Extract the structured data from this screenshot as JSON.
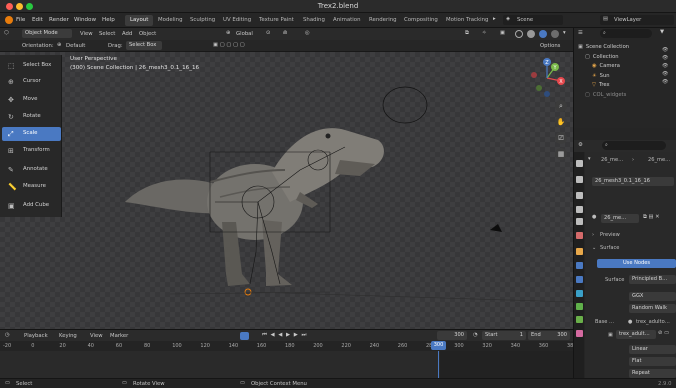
{
  "window": {
    "title": "Trex2.blend"
  },
  "colors": {
    "accent": "#4a79c2",
    "close": "#ff5f57",
    "minimize": "#febc2e",
    "zoom": "#28c840",
    "playhead": "#4a79c2"
  },
  "menu": {
    "items": [
      "File",
      "Edit",
      "Render",
      "Window",
      "Help"
    ],
    "workspaces": [
      "Layout",
      "Modeling",
      "Sculpting",
      "UV Editing",
      "Texture Paint",
      "Shading",
      "Animation",
      "Rendering",
      "Compositing",
      "Motion Tracking"
    ],
    "scene": "Scene",
    "view_layer": "ViewLayer"
  },
  "viewport_header": {
    "mode": "Object Mode",
    "menus": [
      "View",
      "Select",
      "Add",
      "Object"
    ],
    "transform": "Global"
  },
  "viewport_sub": {
    "orientation_label": "Orientation:",
    "orientation_value": "Default",
    "drag_label": "Drag:",
    "drag_value": "Select Box",
    "options": "Options"
  },
  "viewport": {
    "view_name": "User Perspective",
    "collection_info": "(300) Scene Collection | 26_mesh3_0.1_16_16",
    "gizmo_axes": [
      "X",
      "Y",
      "Z"
    ]
  },
  "tools": [
    {
      "label": "Select Box",
      "icon": "select-box-icon",
      "glyph": "⬚",
      "active": false
    },
    {
      "label": "Cursor",
      "icon": "cursor-icon",
      "glyph": "⊕",
      "active": false
    },
    {
      "label": "Move",
      "icon": "move-icon",
      "glyph": "✥",
      "active": false
    },
    {
      "label": "Rotate",
      "icon": "rotate-icon",
      "glyph": "↻",
      "active": false
    },
    {
      "label": "Scale",
      "icon": "scale-icon",
      "glyph": "⤢",
      "active": true
    },
    {
      "label": "Transform",
      "icon": "transform-icon",
      "glyph": "⊞",
      "active": false
    },
    {
      "label": "Annotate",
      "icon": "annotate-icon",
      "glyph": "✎",
      "active": false
    },
    {
      "label": "Measure",
      "icon": "measure-icon",
      "glyph": "📏",
      "active": false
    },
    {
      "label": "Add Cube",
      "icon": "add-cube-icon",
      "glyph": "▣",
      "active": false
    }
  ],
  "outliner": {
    "rows": [
      {
        "label": "Scene Collection",
        "indent": 0
      },
      {
        "label": "Collection",
        "indent": 1
      },
      {
        "label": "Camera",
        "indent": 2
      },
      {
        "label": "Sun",
        "indent": 2
      },
      {
        "label": "Trex",
        "indent": 2
      },
      {
        "label": "COL_widgets",
        "indent": 1
      }
    ]
  },
  "properties": {
    "breadcrumb_a": "26_me…",
    "breadcrumb_b": "26_me…",
    "object_name": "26_mesh3_0.1_16_16",
    "material_slot": "26_me…",
    "preview_label": "Preview",
    "surface_section": "Surface",
    "use_nodes": "Use Nodes",
    "surface_label": "Surface",
    "surface_value": "Principled B…",
    "distribution": "GGX",
    "subsurface_method": "Random Walk",
    "base_color_label": "Base …",
    "base_color_value": "trex_adulto…",
    "image_name": "trex_adult…",
    "interpolation": "Linear",
    "projection": "Flat",
    "extension": "Repeat"
  },
  "timeline": {
    "menus": [
      "Playback",
      "Keying",
      "View",
      "Marker"
    ],
    "current_frame": "300",
    "start_label": "Start",
    "start_value": "1",
    "end_label": "End",
    "end_value": "300",
    "ticks": [
      "-20",
      "0",
      "20",
      "40",
      "60",
      "80",
      "100",
      "120",
      "140",
      "160",
      "180",
      "200",
      "220",
      "240",
      "260",
      "280",
      "300",
      "320",
      "340",
      "360",
      "380",
      "400"
    ],
    "playhead_label": "300"
  },
  "status": {
    "select": "Select",
    "rotate_view": "Rotate View",
    "context_menu": "Object Context Menu",
    "version": "2.9.0"
  }
}
